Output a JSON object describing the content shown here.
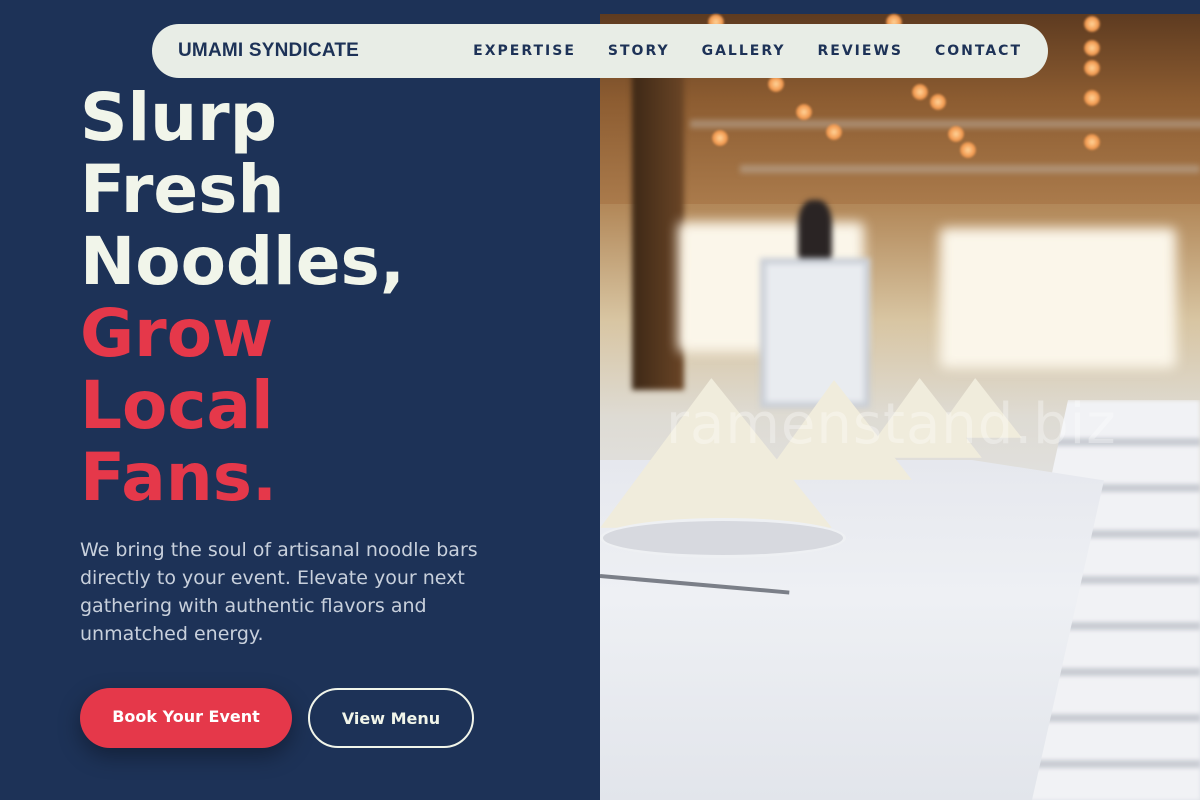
{
  "nav": {
    "brand": "UMAMI SYNDICATE",
    "links": [
      {
        "label": "EXPERTISE"
      },
      {
        "label": "STORY"
      },
      {
        "label": "GALLERY"
      },
      {
        "label": "REVIEWS"
      },
      {
        "label": "CONTACT"
      }
    ]
  },
  "hero": {
    "headline_lines": [
      {
        "text": "Slurp"
      },
      {
        "text": "Fresh"
      },
      {
        "text": "Noodles,"
      },
      {
        "text": "Grow"
      },
      {
        "text": "Local"
      },
      {
        "text": "Fans."
      }
    ],
    "description": "We bring the soul of artisanal noodle bars directly to your event. Elevate your next gathering with authentic flavors and unmatched energy.",
    "primary_cta": "Book Your Event",
    "secondary_cta": "View Menu"
  },
  "photo": {
    "watermark": "ramenstand.biz"
  },
  "colors": {
    "background": "#1d3257",
    "accent": "#e5384a",
    "headline_light": "#f1f5ea",
    "nav_bg": "#e8ede6"
  }
}
